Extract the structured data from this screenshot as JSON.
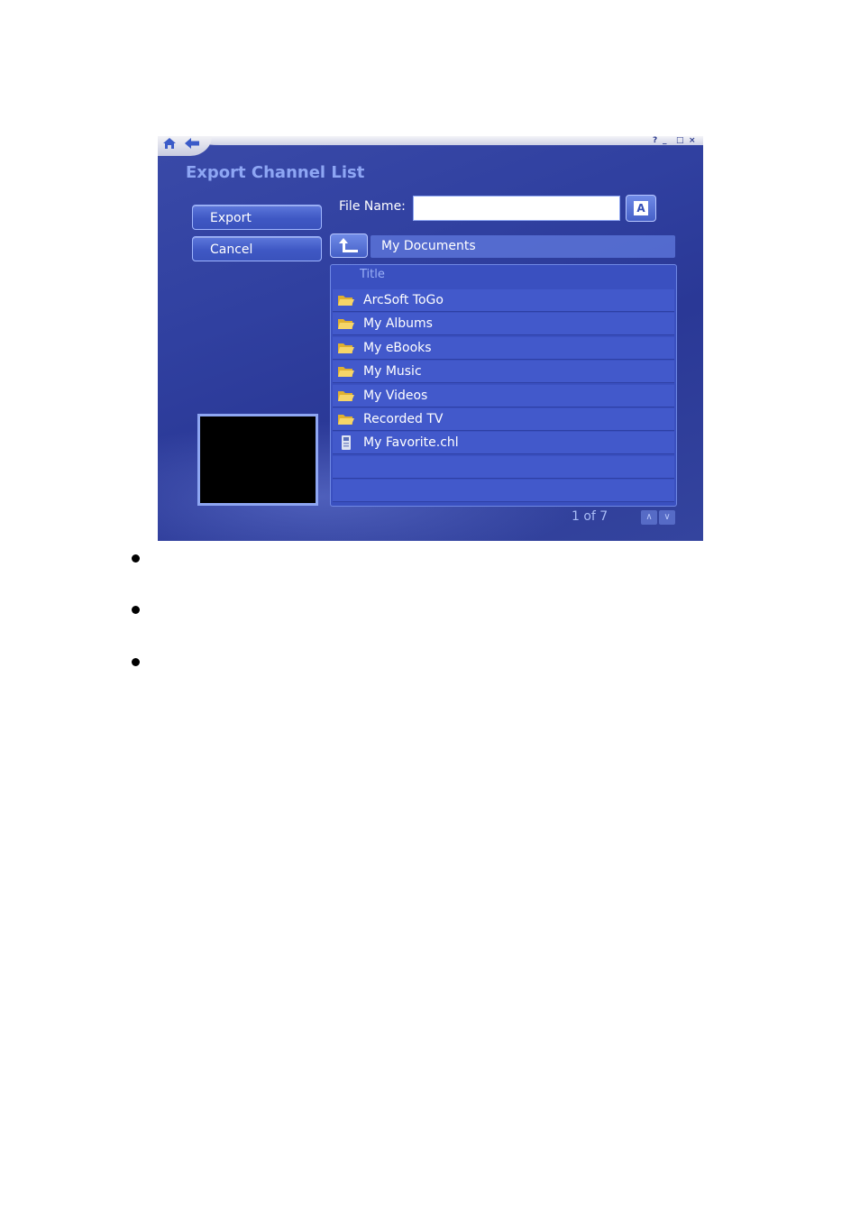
{
  "dialog": {
    "title": "Export Channel List",
    "window_controls": [
      "?",
      "_",
      "□",
      "×"
    ]
  },
  "buttons": {
    "export_label": "Export",
    "cancel_label": "Cancel"
  },
  "file_name": {
    "label": "File Name:",
    "value": ""
  },
  "location": {
    "current_folder": "My Documents"
  },
  "file_list": {
    "column_header": "Title",
    "items": [
      {
        "label": "ArcSoft ToGo",
        "icon": "folder-icon"
      },
      {
        "label": "My Albums",
        "icon": "folder-icon"
      },
      {
        "label": "My eBooks",
        "icon": "folder-icon"
      },
      {
        "label": "My Music",
        "icon": "folder-icon"
      },
      {
        "label": "My Videos",
        "icon": "folder-icon"
      },
      {
        "label": "Recorded TV",
        "icon": "folder-icon"
      },
      {
        "label": "My Favorite.chl",
        "icon": "channel-file-icon"
      }
    ]
  },
  "pagination": {
    "text": "1 of 7"
  },
  "colors": {
    "background": "#3040a0",
    "title": "#8ea6f4",
    "row": "#4259cb",
    "button": "#4560c8"
  }
}
